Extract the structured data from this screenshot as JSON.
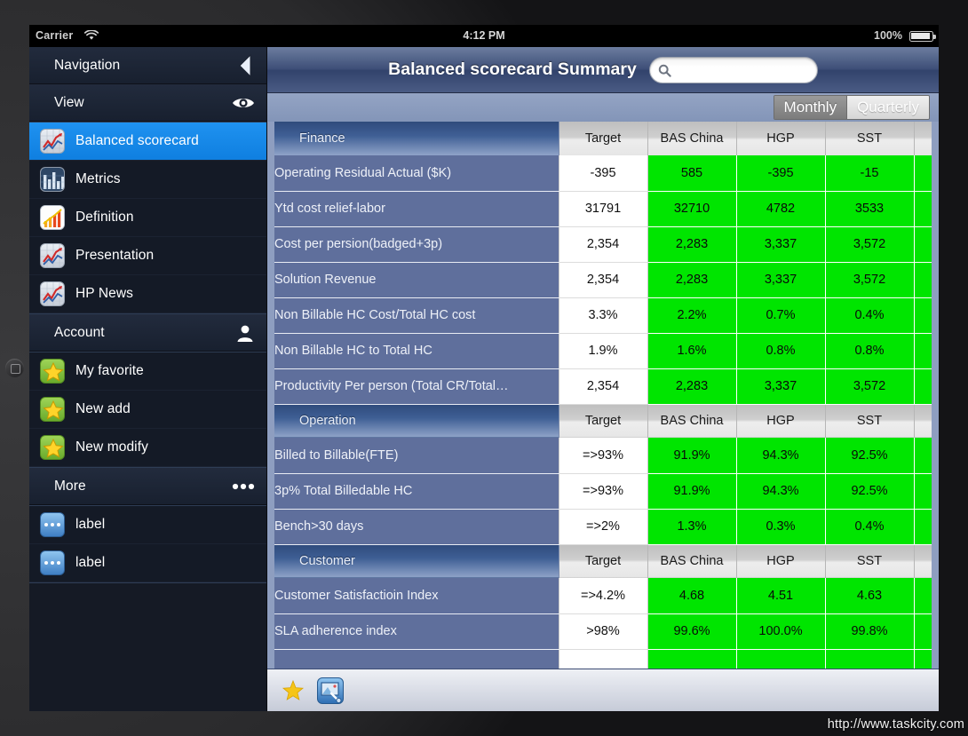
{
  "status_bar": {
    "carrier": "Carrier",
    "wifi_icon": "wifi-icon",
    "time": "4:12 PM",
    "battery_percent": "100%",
    "battery_icon": "battery-full-icon"
  },
  "sidebar": {
    "sections": [
      {
        "header": {
          "label": "Navigation",
          "icon": "chevron-left-icon"
        },
        "items": [
          {
            "label": "Balanced scorecard",
            "icon": "line-chart-grid-icon",
            "selected": true
          },
          {
            "label": "Metrics",
            "icon": "bar-chart-icon",
            "selected": false
          },
          {
            "label": "Definition",
            "icon": "definition-chart-icon",
            "selected": false
          },
          {
            "label": "Presentation",
            "icon": "line-chart-grid-icon",
            "selected": false
          },
          {
            "label": "HP News",
            "icon": "line-chart-grid-icon",
            "selected": false
          }
        ]
      },
      {
        "header": {
          "label": "View",
          "icon": "eye-icon"
        },
        "items": []
      },
      {
        "header": {
          "label": "Account",
          "icon": "person-icon"
        },
        "items": [
          {
            "label": "My favorite",
            "icon": "star-icon",
            "selected": false
          },
          {
            "label": "New add",
            "icon": "star-icon",
            "selected": false
          },
          {
            "label": "New modify",
            "icon": "star-icon",
            "selected": false
          }
        ]
      },
      {
        "header": {
          "label": "More",
          "icon": "ellipsis-icon"
        },
        "items": [
          {
            "label": "label",
            "icon": "ellipsis-box-icon",
            "selected": false
          },
          {
            "label": "label",
            "icon": "ellipsis-box-icon",
            "selected": false
          }
        ]
      }
    ]
  },
  "header": {
    "title": "Balanced scorecard Summary",
    "search": {
      "value": "",
      "placeholder": "",
      "icon": "search-icon"
    }
  },
  "segmented_control": {
    "options": [
      {
        "label": "Monthly",
        "active": false
      },
      {
        "label": "Quarterly",
        "active": true
      }
    ]
  },
  "table": {
    "columns": [
      "Target",
      "BAS China",
      "HGP",
      "SST"
    ],
    "sections": [
      {
        "title": "Finance",
        "rows": [
          {
            "name": "Operating Residual Actual ($K)",
            "target": "-395",
            "values": [
              "585",
              "-395",
              "-15"
            ]
          },
          {
            "name": "Ytd cost relief-labor",
            "target": "31791",
            "values": [
              "32710",
              "4782",
              "3533"
            ]
          },
          {
            "name": "Cost per persion(badged+3p)",
            "target": "2,354",
            "values": [
              "2,283",
              "3,337",
              "3,572"
            ]
          },
          {
            "name": "Solution Revenue",
            "target": "2,354",
            "values": [
              "2,283",
              "3,337",
              "3,572"
            ]
          },
          {
            "name": "Non Billable HC Cost/Total HC cost",
            "target": "3.3%",
            "values": [
              "2.2%",
              "0.7%",
              "0.4%"
            ]
          },
          {
            "name": "Non Billable HC to Total HC",
            "target": "1.9%",
            "values": [
              "1.6%",
              "0.8%",
              "0.8%"
            ]
          },
          {
            "name": "Productivity Per person (Total CR/Total…",
            "target": "2,354",
            "values": [
              "2,283",
              "3,337",
              "3,572"
            ]
          }
        ]
      },
      {
        "title": "Operation",
        "rows": [
          {
            "name": "Billed to Billable(FTE)",
            "target": "=>93%",
            "values": [
              "91.9%",
              "94.3%",
              "92.5%"
            ]
          },
          {
            "name": "3p% Total Billedable HC",
            "target": "=>93%",
            "values": [
              "91.9%",
              "94.3%",
              "92.5%"
            ]
          },
          {
            "name": "Bench>30 days",
            "target": "=>2%",
            "values": [
              "1.3%",
              "0.3%",
              "0.4%"
            ]
          }
        ]
      },
      {
        "title": "Customer",
        "rows": [
          {
            "name": "Customer Satisfactioin Index",
            "target": "=>4.2%",
            "values": [
              "4.68",
              "4.51",
              "4.63"
            ]
          },
          {
            "name": "SLA adherence index",
            "target": ">98%",
            "values": [
              "99.6%",
              "100.0%",
              "99.8%"
            ]
          },
          {
            "name": "",
            "target": "",
            "values": [
              "",
              "",
              ""
            ]
          }
        ]
      }
    ]
  },
  "toolbar": {
    "buttons": [
      {
        "name": "favorite",
        "icon": "star-icon"
      },
      {
        "name": "presentation",
        "icon": "image-tool-icon"
      }
    ]
  },
  "watermark": "http://www.taskcity.com"
}
